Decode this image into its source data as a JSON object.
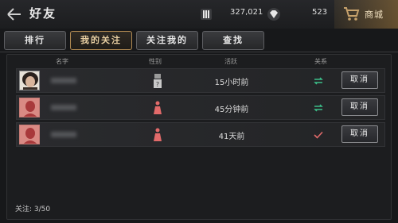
{
  "header": {
    "title": "好友",
    "currency1": "327,021",
    "currency2": "523",
    "shop_label": "商城"
  },
  "tabs": [
    {
      "label": "排行",
      "active": false
    },
    {
      "label": "我的关注",
      "active": true
    },
    {
      "label": "关注我的",
      "active": false
    },
    {
      "label": "查找",
      "active": false
    }
  ],
  "columns": {
    "name": "名字",
    "gender": "性别",
    "activity": "活跃",
    "relation": "关系"
  },
  "rows": [
    {
      "activity": "15小时前",
      "relation": "mutual",
      "gender": "unknown",
      "avatar": "photo",
      "action": "取消"
    },
    {
      "activity": "45分钟前",
      "relation": "mutual",
      "gender": "female",
      "avatar": "female-silhouette",
      "action": "取消"
    },
    {
      "activity": "41天前",
      "relation": "following",
      "gender": "female",
      "avatar": "female-silhouette",
      "action": "取消"
    }
  ],
  "footer": {
    "follow_count": "关注: 3/50"
  },
  "colors": {
    "accent": "#b08a52",
    "mutual": "#3cbf8a",
    "following": "#e06a6a",
    "female": "#e26a6a"
  },
  "icons": {
    "back": "back-arrow-icon",
    "currency1": "ticket-icon",
    "currency2": "diamond-icon",
    "shop": "shopping-cart-icon"
  }
}
